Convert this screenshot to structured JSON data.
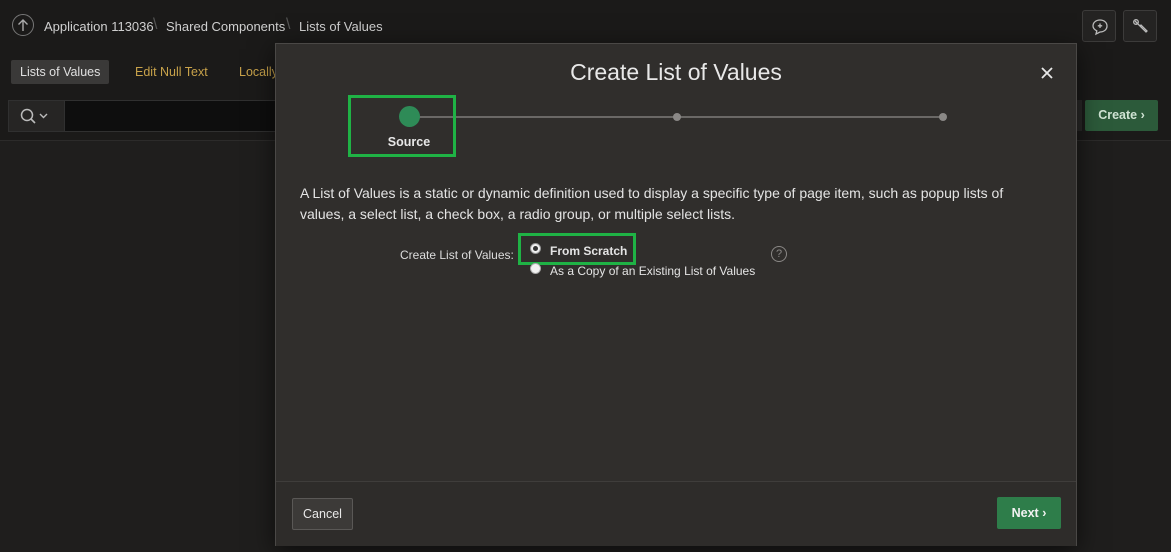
{
  "breadcrumb": {
    "items": [
      "Application 113036",
      "Shared Components",
      "Lists of Values"
    ]
  },
  "tabs": {
    "items": [
      {
        "label": "Lists of Values",
        "active": true
      },
      {
        "label": "Edit Null Text",
        "active": false
      },
      {
        "label": "Locally",
        "active": false
      }
    ]
  },
  "search": {
    "placeholder": ""
  },
  "toolbar": {
    "create_label": "Create"
  },
  "dialog": {
    "title": "Create List of Values",
    "steps": [
      {
        "label": "Source",
        "current": true
      },
      {
        "label": "",
        "current": false
      },
      {
        "label": "",
        "current": false
      }
    ],
    "description": "A List of Values is a static or dynamic definition used to display a specific type of page item, such as popup lists of values, a select list, a check box, a radio group, or multiple select lists.",
    "field_label": "Create List of Values:",
    "options": [
      {
        "label": "From Scratch",
        "selected": true
      },
      {
        "label": "As a Copy of an Existing List of Values",
        "selected": false
      }
    ],
    "help_glyph": "?",
    "cancel_label": "Cancel",
    "next_label": "Next"
  },
  "colors": {
    "accent_green": "#2e7d4a",
    "highlight_green": "#1fb245",
    "link_gold": "#c8a24a"
  }
}
